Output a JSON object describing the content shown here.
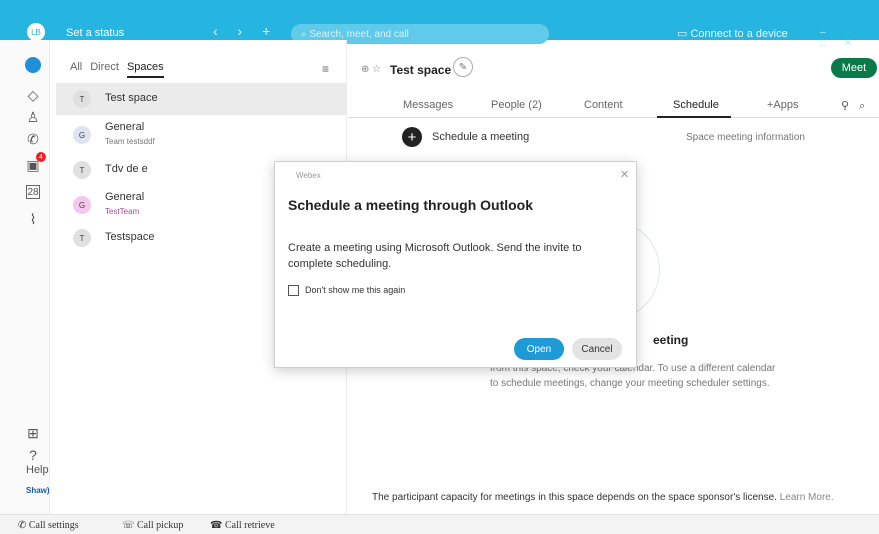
{
  "topbar": {
    "avatar_initials": "LB",
    "status": "Set a status",
    "nav": "‹ › +",
    "search_placeholder": "Search, meet, and call",
    "connect": "Connect to a device"
  },
  "rail": {
    "badge": "4",
    "calendar_date": "28",
    "help_label": "Help",
    "brand": "Shaw)"
  },
  "filters": {
    "all": "All",
    "direct": "Direct",
    "spaces": "Spaces"
  },
  "spaces": [
    {
      "initial": "T",
      "title": "Test space",
      "subtitle": "",
      "color": "#e0e0e0"
    },
    {
      "initial": "G",
      "title": "General",
      "subtitle": "Team testsddf",
      "color": "#dfe4f3"
    },
    {
      "initial": "T",
      "title": "Tdv de e",
      "subtitle": "",
      "color": "#e0e0e0"
    },
    {
      "initial": "G",
      "title": "General",
      "subtitle": "TestTeam",
      "color": "#f5c7ec"
    },
    {
      "initial": "T",
      "title": "Testspace",
      "subtitle": "",
      "color": "#e0e0e0"
    }
  ],
  "space_header": {
    "title": "Test space",
    "meet": "Meet"
  },
  "tabs": [
    "Messages",
    "People (2)",
    "Content",
    "Schedule",
    "+Apps"
  ],
  "schedule": {
    "action": "Schedule a meeting",
    "info": "Space meeting information"
  },
  "background": {
    "heading": "eeting",
    "text": "from this space, check your calendar. To use a different calendar to schedule meetings, change your meeting scheduler settings.",
    "capacity": "The participant capacity for meetings in this space depends on the space sponsor's license.",
    "learn_more": "Learn More."
  },
  "dialog": {
    "app": "Webex",
    "title": "Schedule a meeting through Outlook",
    "body": "Create a meeting using Microsoft Outlook. Send the invite to complete scheduling.",
    "checkbox_label": "Don't show me this again",
    "open": "Open",
    "cancel": "Cancel"
  },
  "bottombar": {
    "call_settings": "Call settings",
    "call_pickup": "Call pickup",
    "call_retrieve": "Call retrieve"
  }
}
